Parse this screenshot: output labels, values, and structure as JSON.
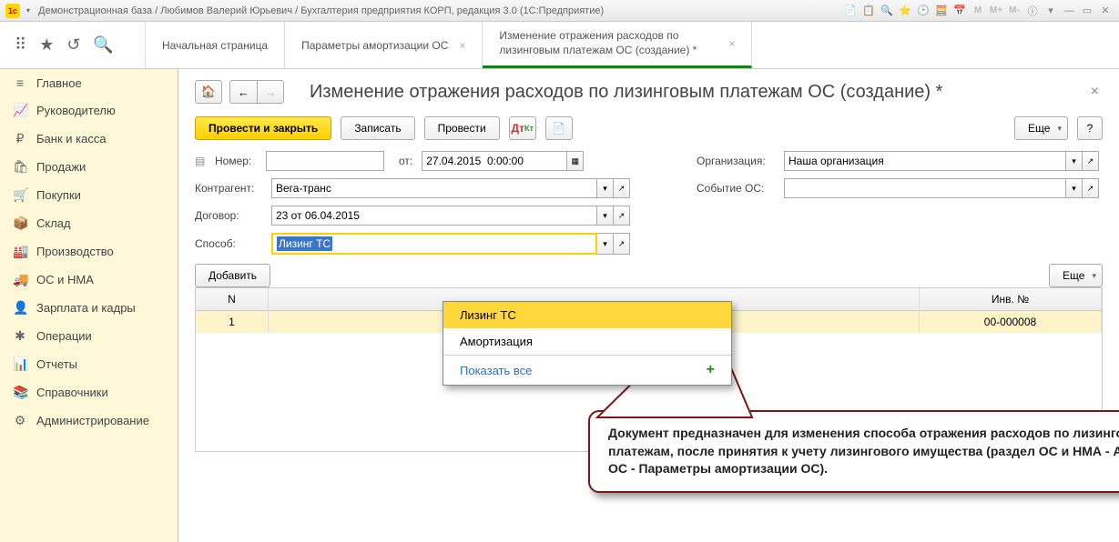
{
  "titlebar": {
    "title": "Демонстрационная база / Любимов Валерий Юрьевич / Бухгалтерия предприятия КОРП, редакция 3.0  (1С:Предприятие)"
  },
  "tabs": {
    "home": "Начальная страница",
    "t1": "Параметры амортизации ОС",
    "t2": "Изменение отражения расходов по лизинговым платежам ОС (создание) *"
  },
  "sidebar": {
    "items": [
      {
        "label": "Главное",
        "icon": "≡"
      },
      {
        "label": "Руководителю",
        "icon": "📈"
      },
      {
        "label": "Банк и касса",
        "icon": "₽"
      },
      {
        "label": "Продажи",
        "icon": "🛍"
      },
      {
        "label": "Покупки",
        "icon": "🛒"
      },
      {
        "label": "Склад",
        "icon": "📦"
      },
      {
        "label": "Производство",
        "icon": "🏭"
      },
      {
        "label": "ОС и НМА",
        "icon": "🚚"
      },
      {
        "label": "Зарплата и кадры",
        "icon": "👤"
      },
      {
        "label": "Операции",
        "icon": "✱"
      },
      {
        "label": "Отчеты",
        "icon": "📊"
      },
      {
        "label": "Справочники",
        "icon": "📚"
      },
      {
        "label": "Администрирование",
        "icon": "⚙"
      }
    ]
  },
  "page": {
    "title": "Изменение отражения расходов по лизинговым платежам ОС (создание) *"
  },
  "buttons": {
    "post_close": "Провести и закрыть",
    "write": "Записать",
    "post": "Провести",
    "more": "Еще",
    "add": "Добавить"
  },
  "form": {
    "number_label": "Номер:",
    "number_value": "",
    "from_label": "от:",
    "date_value": "27.04.2015  0:00:00",
    "counterparty_label": "Контрагент:",
    "counterparty_value": "Вега-транс",
    "contract_label": "Договор:",
    "contract_value": "23 от 06.04.2015",
    "method_label": "Способ:",
    "method_value": "Лизинг ТС",
    "org_label": "Организация:",
    "org_value": "Наша организация",
    "event_label": "Событие ОС:",
    "event_value": ""
  },
  "dropdown": {
    "opt1": "Лизинг ТС",
    "opt2": "Амортизация",
    "show_all": "Показать все"
  },
  "table": {
    "col_n": "N",
    "col_inv": "Инв. №",
    "row1_n": "1",
    "row1_inv": "00-000008"
  },
  "callout": {
    "text": "Документ предназначен для изменения способа отражения расходов по лизинговым платежам, после принятия к учету лизингового имущества (раздел ОС и НМА - Амортизация ОС - Параметры амортизации ОС)."
  }
}
